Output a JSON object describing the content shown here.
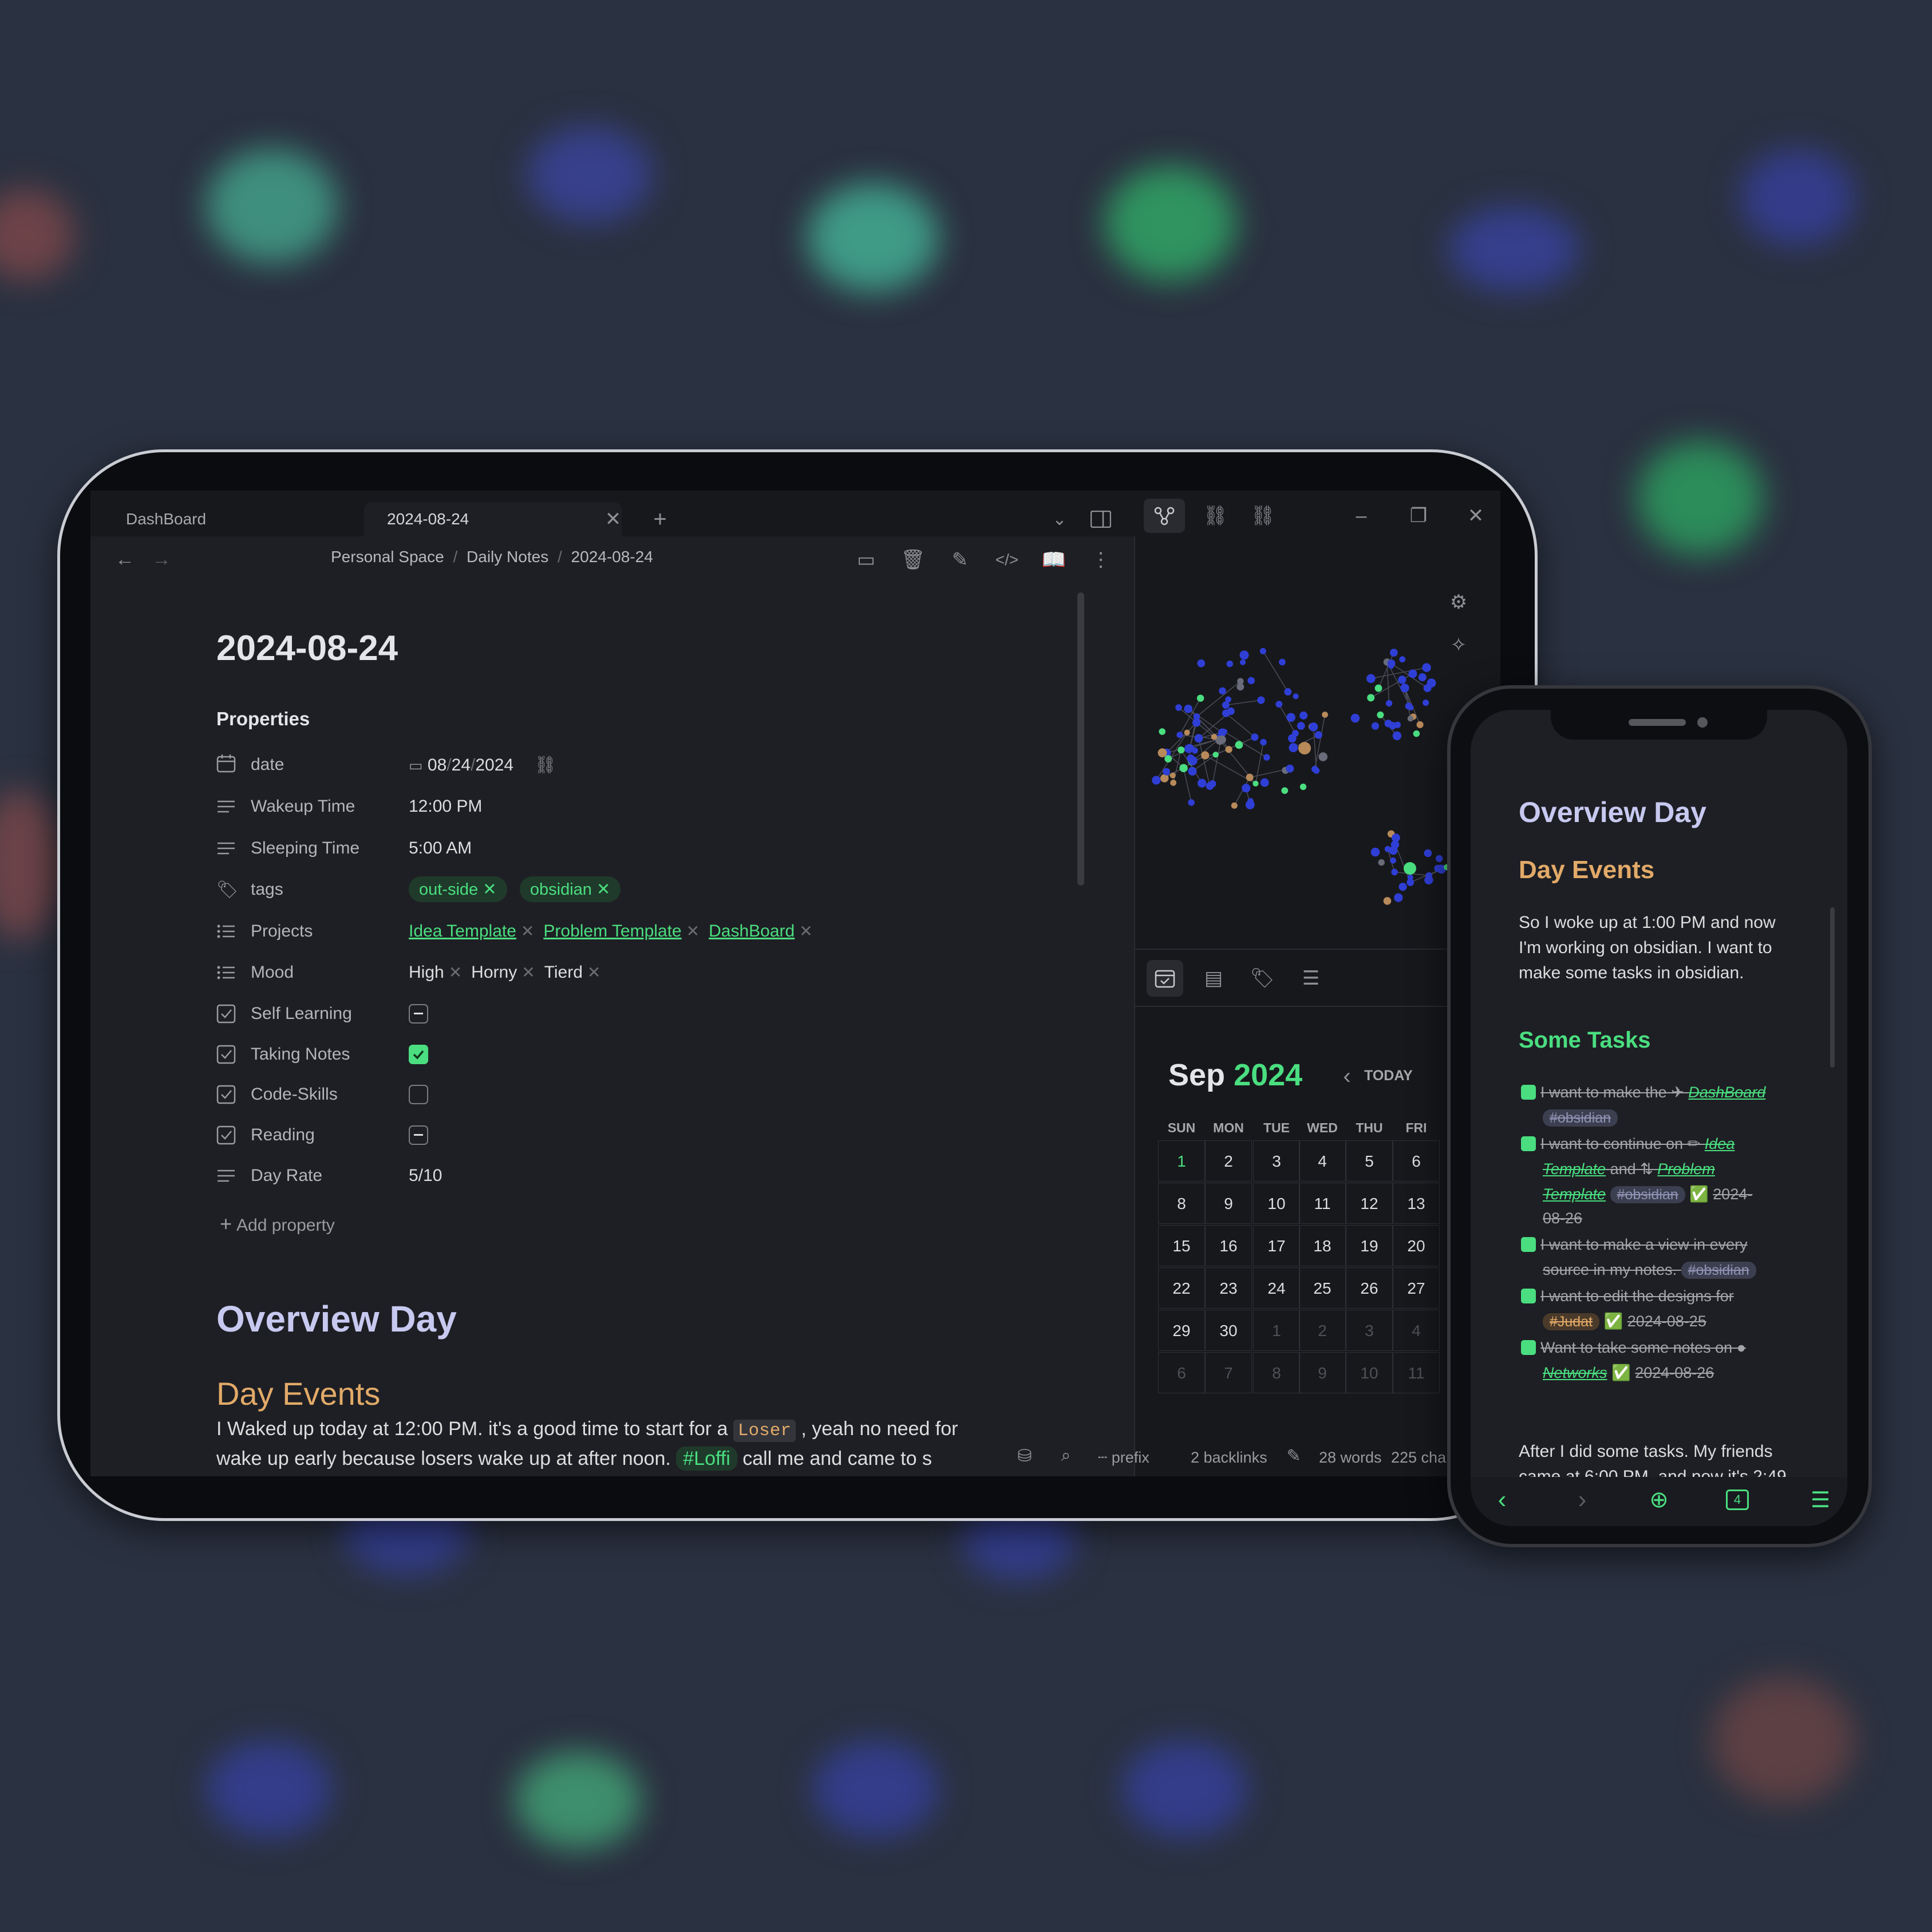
{
  "tablet": {
    "tabs": [
      {
        "label": "DashBoard"
      },
      {
        "label": "2024-08-24"
      }
    ],
    "breadcrumb": {
      "part1": "Personal Space",
      "sep": "/",
      "part2": "Daily Notes",
      "part3": "2024-08-24"
    },
    "note_title": "2024-08-24",
    "properties_label": "Properties",
    "properties": {
      "date": {
        "name": "date",
        "m": "08",
        "d": "24",
        "y": "2024",
        "sep": "/"
      },
      "wakeup": {
        "name": "Wakeup Time",
        "value": "12:00 PM"
      },
      "sleeping": {
        "name": "Sleeping Time",
        "value": "5:00 AM"
      },
      "tags": {
        "name": "tags",
        "items": [
          "out-side",
          "obsidian"
        ]
      },
      "projects": {
        "name": "Projects",
        "items": [
          "Idea Template",
          "Problem Template",
          "DashBoard"
        ]
      },
      "mood": {
        "name": "Mood",
        "items": [
          "High",
          "Horny",
          "Tierd"
        ]
      },
      "self_learning": {
        "name": "Self Learning",
        "state": "indeterminate"
      },
      "taking_notes": {
        "name": "Taking Notes",
        "state": "checked"
      },
      "code_skills": {
        "name": "Code-Skills",
        "state": "unchecked"
      },
      "reading": {
        "name": "Reading",
        "state": "indeterminate"
      },
      "day_rate": {
        "name": "Day Rate",
        "value": "5/10"
      }
    },
    "add_property": "Add property",
    "heading1": "Overview Day",
    "heading2": "Day Events",
    "para_line1_a": "I Waked up today at 12:00 PM. it's a good time to start for a ",
    "para_line1_code": "Loser",
    "para_line1_b": " , yeah no need for",
    "para_line2_a": "wake up early because losers wake up at after noon. ",
    "para_line2_tag": "#Loffi",
    "para_line2_b": " call me and came to s",
    "calendar": {
      "month": "Sep",
      "year": "2024",
      "today_label": "TODAY",
      "weekdays": [
        "SUN",
        "MON",
        "TUE",
        "WED",
        "THU",
        "FRI",
        "S"
      ],
      "rows": [
        [
          "1",
          "2",
          "3",
          "4",
          "5",
          "6"
        ],
        [
          "8",
          "9",
          "10",
          "11",
          "12",
          "13"
        ],
        [
          "15",
          "16",
          "17",
          "18",
          "19",
          "20"
        ],
        [
          "22",
          "23",
          "24",
          "25",
          "26",
          "27"
        ],
        [
          "29",
          "30",
          "1",
          "2",
          "3",
          "4"
        ],
        [
          "6",
          "7",
          "8",
          "9",
          "10",
          "11"
        ]
      ]
    },
    "status": {
      "prefix": "prefix",
      "backlinks": "2 backlinks",
      "words": "28 words",
      "chars": "225 cha"
    },
    "colors": {
      "accent": "#4ade80",
      "heading1": "#c7c9f0",
      "heading2": "#e2aa68",
      "bg": "#1e1f24"
    }
  },
  "phone": {
    "heading1": "Overview Day",
    "heading2": "Day Events",
    "para": [
      "So I woke up at 1:00 PM and now",
      "I'm working on obsidian. I want to",
      "make some tasks in obsidian."
    ],
    "tasks_heading": "Some Tasks",
    "tasks": {
      "t1a": "I want to make the ✈ ",
      "t1link": "DashBoard",
      "t1tag": "#obsidian",
      "t2a": "I want to continue on ✏ ",
      "t2link1": "Idea",
      "t2link1b": "Template",
      "t2and": " and ⇅ ",
      "t2link2": "Problem",
      "t2link2b": "Template",
      "t2tag": "#obsidian",
      "t2date": "2024-",
      "t2date2": "08-26",
      "t3a": "I want to make a view in every",
      "t3b": "source in my notes. ",
      "t3tag": "#obsidian",
      "t4a": "I want to edit the designs for",
      "t4tag": "#Judat",
      "t4date": "2024-08-25",
      "t5a": "Want to take some notes on ●",
      "t5link": "Networks",
      "t5date": "2024-08-26"
    },
    "after1": "After I did some tasks. My friends",
    "after2": "came at 6:00 PM, and now it's 2:49",
    "tab_count": "4"
  }
}
